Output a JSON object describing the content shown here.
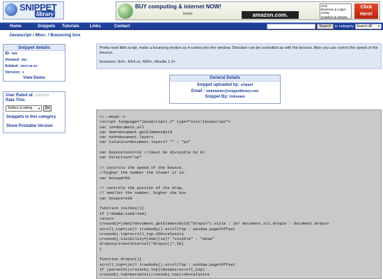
{
  "header": {
    "logo": {
      "word1": "SNIPPET",
      "word2": "library"
    },
    "banner": {
      "buy_text": "BUY computing & internet NOW!",
      "books_text": "books",
      "amazon_text": "amazon.com.",
      "categories": [
        "Unix",
        "Business & Legal",
        "HTML",
        "Graphics & Design"
      ],
      "click_text": "Click Here!"
    }
  },
  "nav": {
    "items": [
      "Home",
      "Snippets",
      "Tutorials",
      "Links",
      "Contact"
    ],
    "search_button": "Search",
    "in_category": "in category",
    "category_selected": "Search All"
  },
  "breadcrumb": "Javascript / Misc. / Bouncing box",
  "details": {
    "title": "Snippet details",
    "id_label": "ID:",
    "id_value": "509",
    "viewed_label": "Viewed:",
    "viewed_value": "951",
    "added_label": "Added:",
    "added_value": "2003-06-10",
    "version_label": "Version:",
    "version_value": "1",
    "demo": "View Demo"
  },
  "rating": {
    "rated_label": "User Rated at:",
    "stars": "☆☆☆☆☆",
    "rate_label": "Rate This:",
    "select_value": "Select a rating",
    "go": "Go",
    "link_category": "Snippets in this category",
    "link_print": "Show Printable Version"
  },
  "description": {
    "text": "Pretty neat little script. make a bouncing motion as it comes into the window. Direction can be controlled as with the bounce. Also you can control the speed of the bounce.",
    "browsers": "browsers: IE4+, NS4.xx, NS6+, Mozilla 1.3+"
  },
  "general": {
    "title": "General Details",
    "uploaded_label": "Snippet uploaded by:",
    "uploaded_value": "snippet",
    "email_label": "Email :",
    "email_value": "webmaster@snippetlibrary.com",
    "by_label": "Snippet By:",
    "by_value": "Unknown"
  },
  "code": "<!--Head-->\n<script language=\"JavaScript1.2\" type=\"text/javascript\">\nvar ie=document.all\nvar dom=document.getElementById\nvar ns4=document.layers\nvar calunits=document.layers? \"\" : \"px\"\n\nvar bouncelimit=32 //(must be divisible by 8)\nvar direction=\"up\"\n\n// controls the speed of the bounce.\n//higher the number the slower it is.\nvar boxspd=50\n\n// controls the postion of the drop,\n// smaller the number, higher the box\nvar boxpos=100\n\nfunction initbox(){\nif (!dom&&!ie&&!ns4)\nreturn\ncrossobj=(dom)?document.getElementById(\"dropin\").style : ie? document.all.dropin : document.dropin\nscroll_top=(ie)? truebody().scrollTop : window.pageYOffset\ncrossobj.top=scroll_top-250+calunits\ncrossobj.visibility=(dom||ie)? \"visible\" : \"show\"\ndropstart=setInterval(\"dropin()\",50)\n}\n\nfunction dropin(){\nscroll_top=(ie)? truebody().scrollTop : window.pageYOffset\nif (parseInt(crossobj.top)<boxpos+scroll_top)\ncrossobj.top=parseInt(crossobj.top)+40+calunits"
}
